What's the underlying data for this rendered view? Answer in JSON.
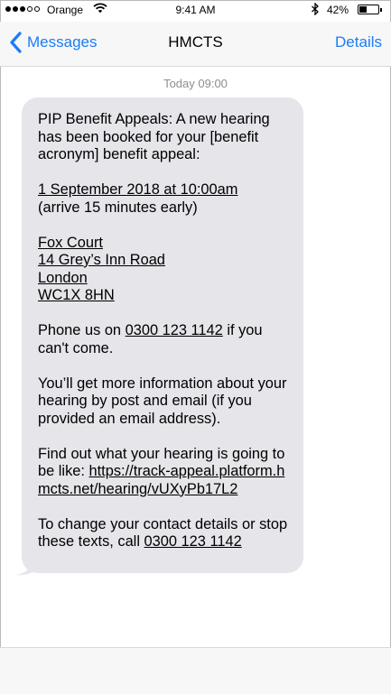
{
  "status_bar": {
    "carrier": "Orange",
    "time": "9:41 AM",
    "battery_percent": "42%",
    "battery_level": 0.42,
    "signal_bars_filled": 3,
    "signal_bars_total": 5,
    "icons": [
      "signal-icon",
      "wifi-icon",
      "bluetooth-icon",
      "battery-icon"
    ]
  },
  "nav": {
    "back_label": "Messages",
    "title": "HMCTS",
    "details_label": "Details",
    "accent_color": "#1a7cf5"
  },
  "conversation": {
    "timestamp": "Today 09:00",
    "message": {
      "intro": "PIP Benefit Appeals: A new hearing has been booked for your [benefit acronym] benefit appeal:",
      "date_time": "1 September 2018 at 10:00am",
      "arrive_note": "(arrive 15 minutes early)",
      "address": [
        "Fox Court",
        "14 Grey’s Inn Road",
        "London",
        "WC1X 8HN"
      ],
      "phone_prefix": "Phone us on ",
      "phone_number": "0300 123 1142",
      "phone_suffix": " if you can't come.",
      "more_info": "You’ll get more information about your hearing by post and email (if you provided an email address).",
      "find_out_prefix": "Find out what your hearing is going to be like: ",
      "hearing_link": "https://track-appeal.platform.hmcts.net/hearing/vUXyPb17L2",
      "change_prefix": "To change your contact details or stop these texts, call ",
      "change_phone": "0300 123 1142"
    }
  }
}
